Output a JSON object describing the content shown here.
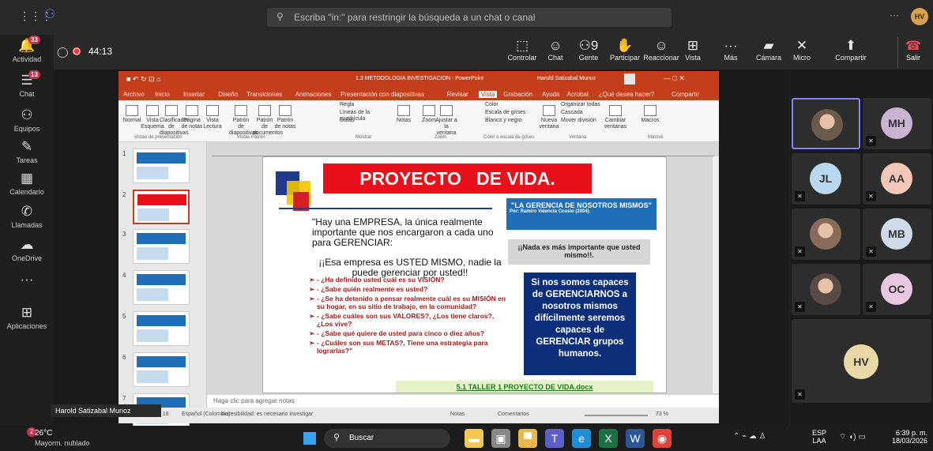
{
  "top": {
    "search_placeholder": "Escriba \"in:\" para restringir la búsqueda a un chat o canal",
    "profile": "HV",
    "more": "···"
  },
  "rail": [
    {
      "label": "Actividad",
      "icon": "bell-icon",
      "badge": "33"
    },
    {
      "label": "Chat",
      "icon": "chat-icon",
      "badge": "13"
    },
    {
      "label": "Equipos",
      "icon": "teams-icon",
      "badge": ""
    },
    {
      "label": "Tareas",
      "icon": "tasks-icon",
      "badge": ""
    },
    {
      "label": "Calendario",
      "icon": "calendar-icon",
      "badge": ""
    },
    {
      "label": "Llamadas",
      "icon": "phone-icon",
      "badge": ""
    },
    {
      "label": "OneDrive",
      "icon": "cloud-icon",
      "badge": ""
    },
    {
      "label": "",
      "icon": "more-icon",
      "badge": ""
    },
    {
      "label": "Aplicaciones",
      "icon": "apps-icon",
      "badge": ""
    }
  ],
  "meeting": {
    "timer": "44:13",
    "controls": [
      {
        "label": "Controlar",
        "glyph": "⬚"
      },
      {
        "label": "Chat",
        "glyph": "☺"
      },
      {
        "label": "Gente",
        "glyph": "⚇9"
      },
      {
        "label": "Participar",
        "glyph": "✋"
      },
      {
        "label": "Reaccionar",
        "glyph": "☺"
      },
      {
        "label": "Vista",
        "glyph": "⊞"
      },
      {
        "label": "Más",
        "glyph": "···"
      },
      {
        "label": "Cámara",
        "glyph": "▰"
      },
      {
        "label": "Micro",
        "glyph": "✕"
      },
      {
        "label": "Compartir",
        "glyph": "⬆"
      }
    ],
    "leave": "Salir",
    "presenter": "Harold Satizabal Munoz"
  },
  "ppt": {
    "title": "1.3 METODOLOGIA INVESTIGACION - PowerPoint",
    "user": "Harold Satizabal Munoz",
    "share": "Compartir",
    "tabs": [
      "Archivo",
      "Inicio",
      "Insertar",
      "Diseño",
      "Transiciones",
      "Animaciones",
      "Presentación con diapositivas",
      "Revisar",
      "Vista",
      "Grabación",
      "Ayuda",
      "Acrobat",
      "¿Qué desea hacer?"
    ],
    "ribbon": [
      "Normal",
      "Vista Esquema",
      "Clasificador de diapositivas",
      "Página de notas",
      "Vista Lectura",
      "Patrón de diapositivas",
      "Patrón de documentos",
      "Patrón de notas",
      "Regla",
      "Líneas de la cuadrícula",
      "Guías",
      "Notas",
      "Zoom",
      "Ajustar a la ventana",
      "Color",
      "Escala de grises",
      "Blanco y negro",
      "Nueva ventana",
      "Organizar todas",
      "Cascada",
      "Mover división",
      "Cambiar ventanas",
      "Macros"
    ],
    "groups": [
      "Vistas de presentación",
      "Vistas Patrón",
      "Mostrar",
      "Zoom",
      "Color o escala de grises",
      "Ventana",
      "Macros"
    ],
    "thumb_numbers": [
      "1",
      "2",
      "3",
      "4",
      "5",
      "6",
      "7"
    ],
    "notes": "Haga clic para agregar notas",
    "status": [
      "Diapositiva 2 de 18",
      "Español (Colombia)",
      "Accesibilidad: es necesario investigar",
      "Notas",
      "Comentarios",
      "73 %"
    ]
  },
  "slide": {
    "title": "PROYECTO   DE VIDA.",
    "quote": "\"Hay una EMPRESA, la única realmente importante que nos encargaron a cada uno para GERENCIAR:",
    "quote2": "¡¡Esa empresa es USTED MISMO, nadie la puede gerenciar por usted!!",
    "questions": [
      "- ¿Ha definido usted cuál es su VISIÓN?",
      "- ¿Sabe quién realmente es usted?",
      "- ¿Se ha detenido a pensar realmente cuál es su MISIÓN en su hogar, en su sitio de trabajo, en la comunidad?",
      "- ¿Sabe cuáles son sus VALORES?, ¿Los tiene claros?, ¿Los vive?",
      "- ¿Sabe qué quiere de usted para cinco o diez años?",
      "- ¿Cuáles son sus METAS?, Tiene una estrategia para lograrlas?\""
    ],
    "box1_title": "\"LA GERENCIA DE NOSOTROS MISMOS\"",
    "box1_author": "Por: Ramiro Valencia Cossio (2004).",
    "box2": "¡¡Nada es más importante que usted mismo!!.",
    "box3": "Si nos somos capaces de GERENCIARNOS a nosotros mismos difícilmente seremos capaces de GERENCIAR grupos humanos.",
    "link": "5.1 TALLER 1 PROYECTO DE VIDA.docx"
  },
  "participants": [
    {
      "initials": "",
      "color": "#6a5a4a",
      "kind": "photo"
    },
    {
      "initials": "MH",
      "color": "#c9b4d4"
    },
    {
      "initials": "JL",
      "color": "#b9d7ee"
    },
    {
      "initials": "AA",
      "color": "#f2c7b8"
    },
    {
      "initials": "",
      "color": "#8a6a5a",
      "kind": "photo"
    },
    {
      "initials": "MB",
      "color": "#cfdbe8"
    },
    {
      "initials": "",
      "color": "#5a4a44",
      "kind": "photo"
    },
    {
      "initials": "OC",
      "color": "#e8c8e0"
    },
    {
      "initials": "HV",
      "color": "#ead9a7"
    }
  ],
  "taskbar": {
    "weather_temp": "26°C",
    "weather_desc": "Mayorm. nublado",
    "weather_badge": "2",
    "search": "Buscar",
    "lang": "ESP",
    "region": "LAA",
    "time": "6:39 p. m.",
    "date": "18/03/2026"
  }
}
